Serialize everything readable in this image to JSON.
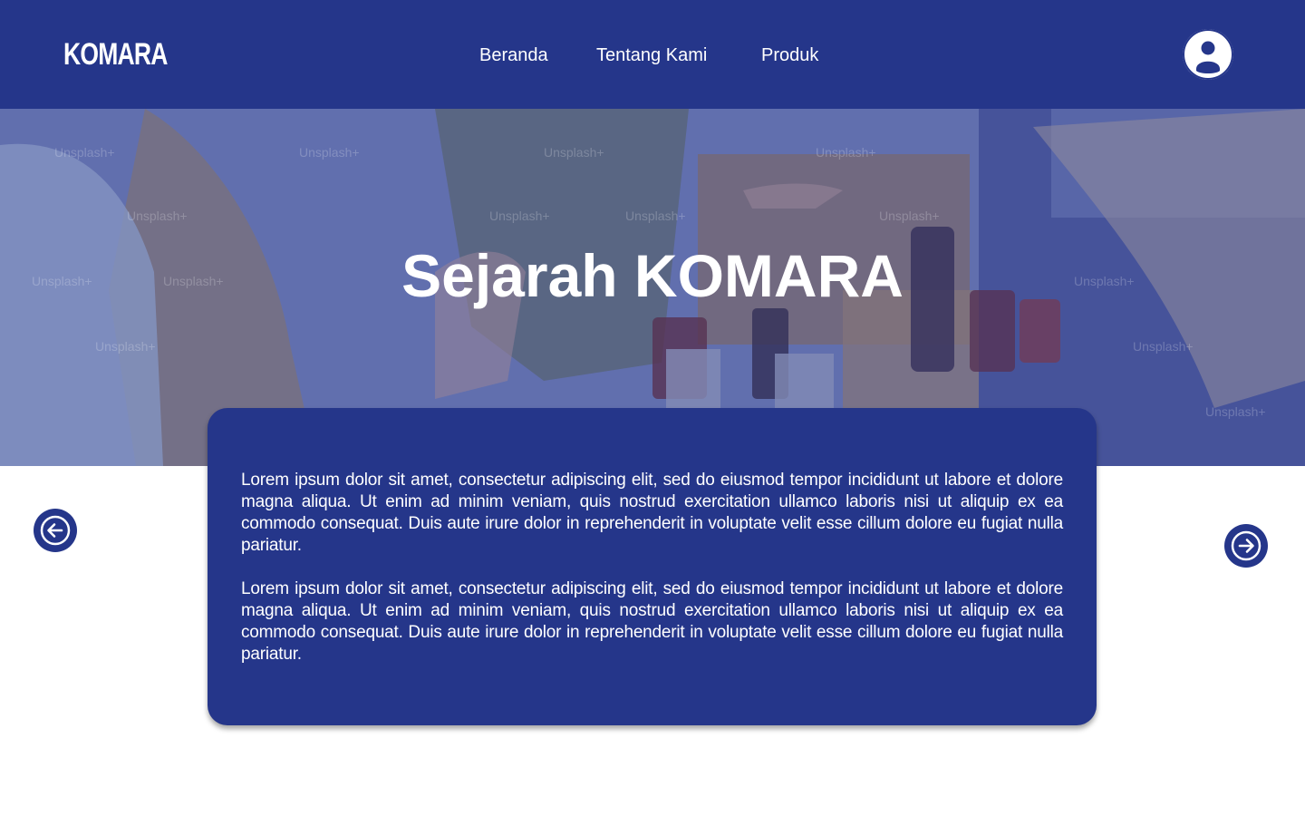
{
  "brand": {
    "logo": "KOMARA"
  },
  "nav": {
    "items": [
      {
        "label": "Beranda"
      },
      {
        "label": "Tentang Kami"
      },
      {
        "label": "Produk"
      }
    ]
  },
  "hero": {
    "title": "Sejarah KOMARA",
    "watermark": "Unsplash+"
  },
  "content": {
    "paragraphs": [
      "Lorem ipsum dolor sit amet, consectetur adipiscing elit, sed do eiusmod tempor incididunt ut labore et dolore magna aliqua. Ut enim ad minim veniam, quis nostrud exercitation ullamco laboris nisi ut aliquip ex ea commodo consequat. Duis aute irure dolor in reprehenderit in voluptate velit esse cillum dolore eu fugiat nulla pariatur.",
      "Lorem ipsum dolor sit amet, consectetur adipiscing elit, sed do eiusmod tempor incididunt ut labore et dolore magna aliqua. Ut enim ad minim veniam, quis nostrud exercitation ullamco laboris nisi ut aliquip ex ea commodo consequat. Duis aute irure dolor in reprehenderit in voluptate velit esse cillum dolore eu fugiat nulla pariatur."
    ]
  },
  "icons": {
    "profile": "user-circle-icon",
    "prev": "arrow-left-icon",
    "next": "arrow-right-icon"
  },
  "colors": {
    "primary": "#25368a",
    "background": "#ffffff",
    "text_on_primary": "#ffffff"
  }
}
